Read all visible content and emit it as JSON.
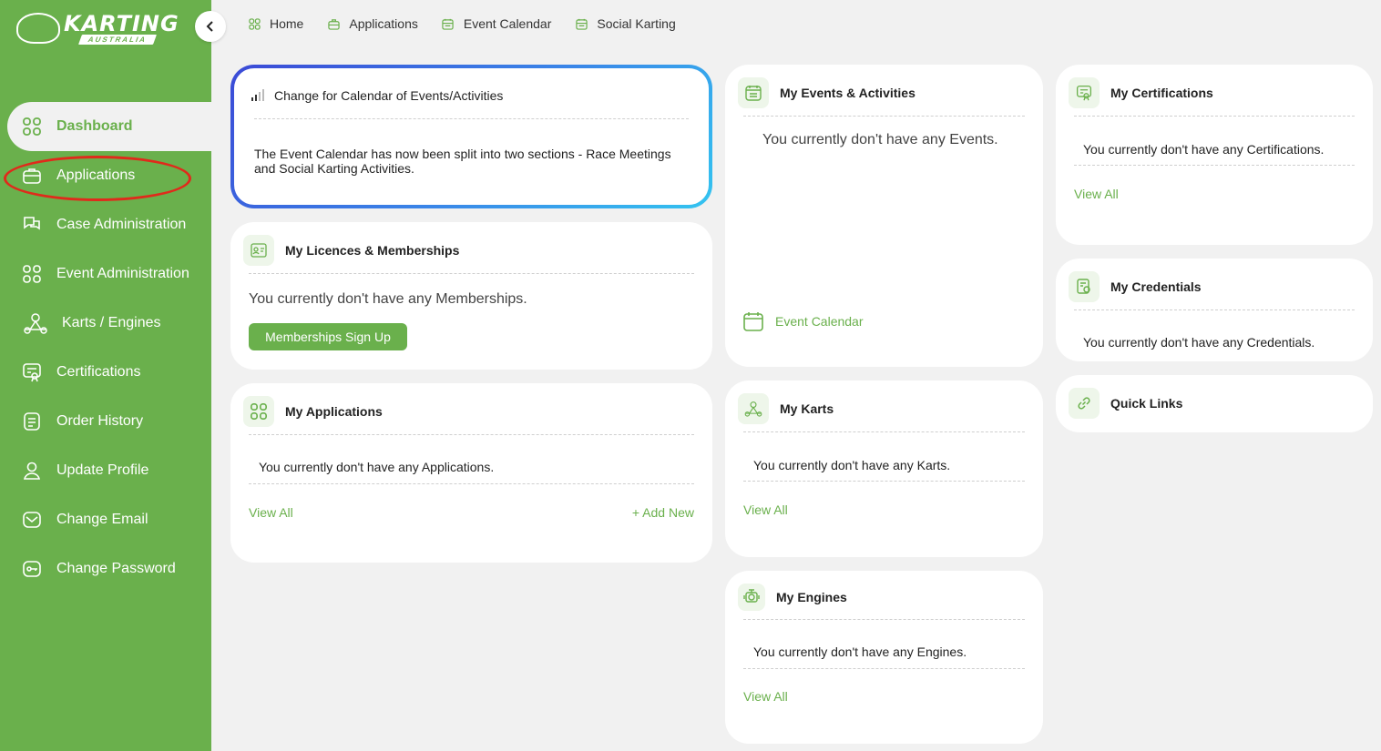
{
  "sidebar": {
    "logo_text": "KARTING",
    "logo_sub": "AUSTRALIA",
    "items": [
      {
        "label": "Dashboard"
      },
      {
        "label": "Applications"
      },
      {
        "label": "Case Administration"
      },
      {
        "label": "Event Administration"
      },
      {
        "label": "Karts / Engines"
      },
      {
        "label": "Certifications"
      },
      {
        "label": "Order History"
      },
      {
        "label": "Update Profile"
      },
      {
        "label": "Change Email"
      },
      {
        "label": "Change Password"
      }
    ]
  },
  "breadcrumb": [
    "Home",
    "Applications",
    "Event Calendar",
    "Social Karting"
  ],
  "notice": {
    "title": "Change for Calendar of Events/Activities",
    "body": "The Event Calendar has now been split into two sections - Race Meetings and Social Karting Activities."
  },
  "licences": {
    "title": "My Licences & Memberships",
    "empty": "You currently don't have any Memberships.",
    "button": "Memberships Sign Up"
  },
  "applications": {
    "title": "My Applications",
    "empty": "You currently don't have any Applications.",
    "view_all": "View All",
    "add_new": "+ Add New"
  },
  "events": {
    "title": "My Events & Activities",
    "empty": "You currently don't have any Events.",
    "link": "Event Calendar"
  },
  "karts": {
    "title": "My Karts",
    "empty": "You currently don't have any Karts.",
    "view_all": "View All"
  },
  "engines": {
    "title": "My Engines",
    "empty": "You currently don't have any Engines.",
    "view_all": "View All"
  },
  "certifications": {
    "title": "My Certifications",
    "empty": "You currently don't have any Certifications.",
    "view_all": "View All"
  },
  "credentials": {
    "title": "My Credentials",
    "empty": "You currently don't have any Credentials."
  },
  "quick_links": {
    "title": "Quick Links"
  },
  "colors": {
    "brand_green": "#6ab04c",
    "annotation_red": "#e02a1b"
  }
}
